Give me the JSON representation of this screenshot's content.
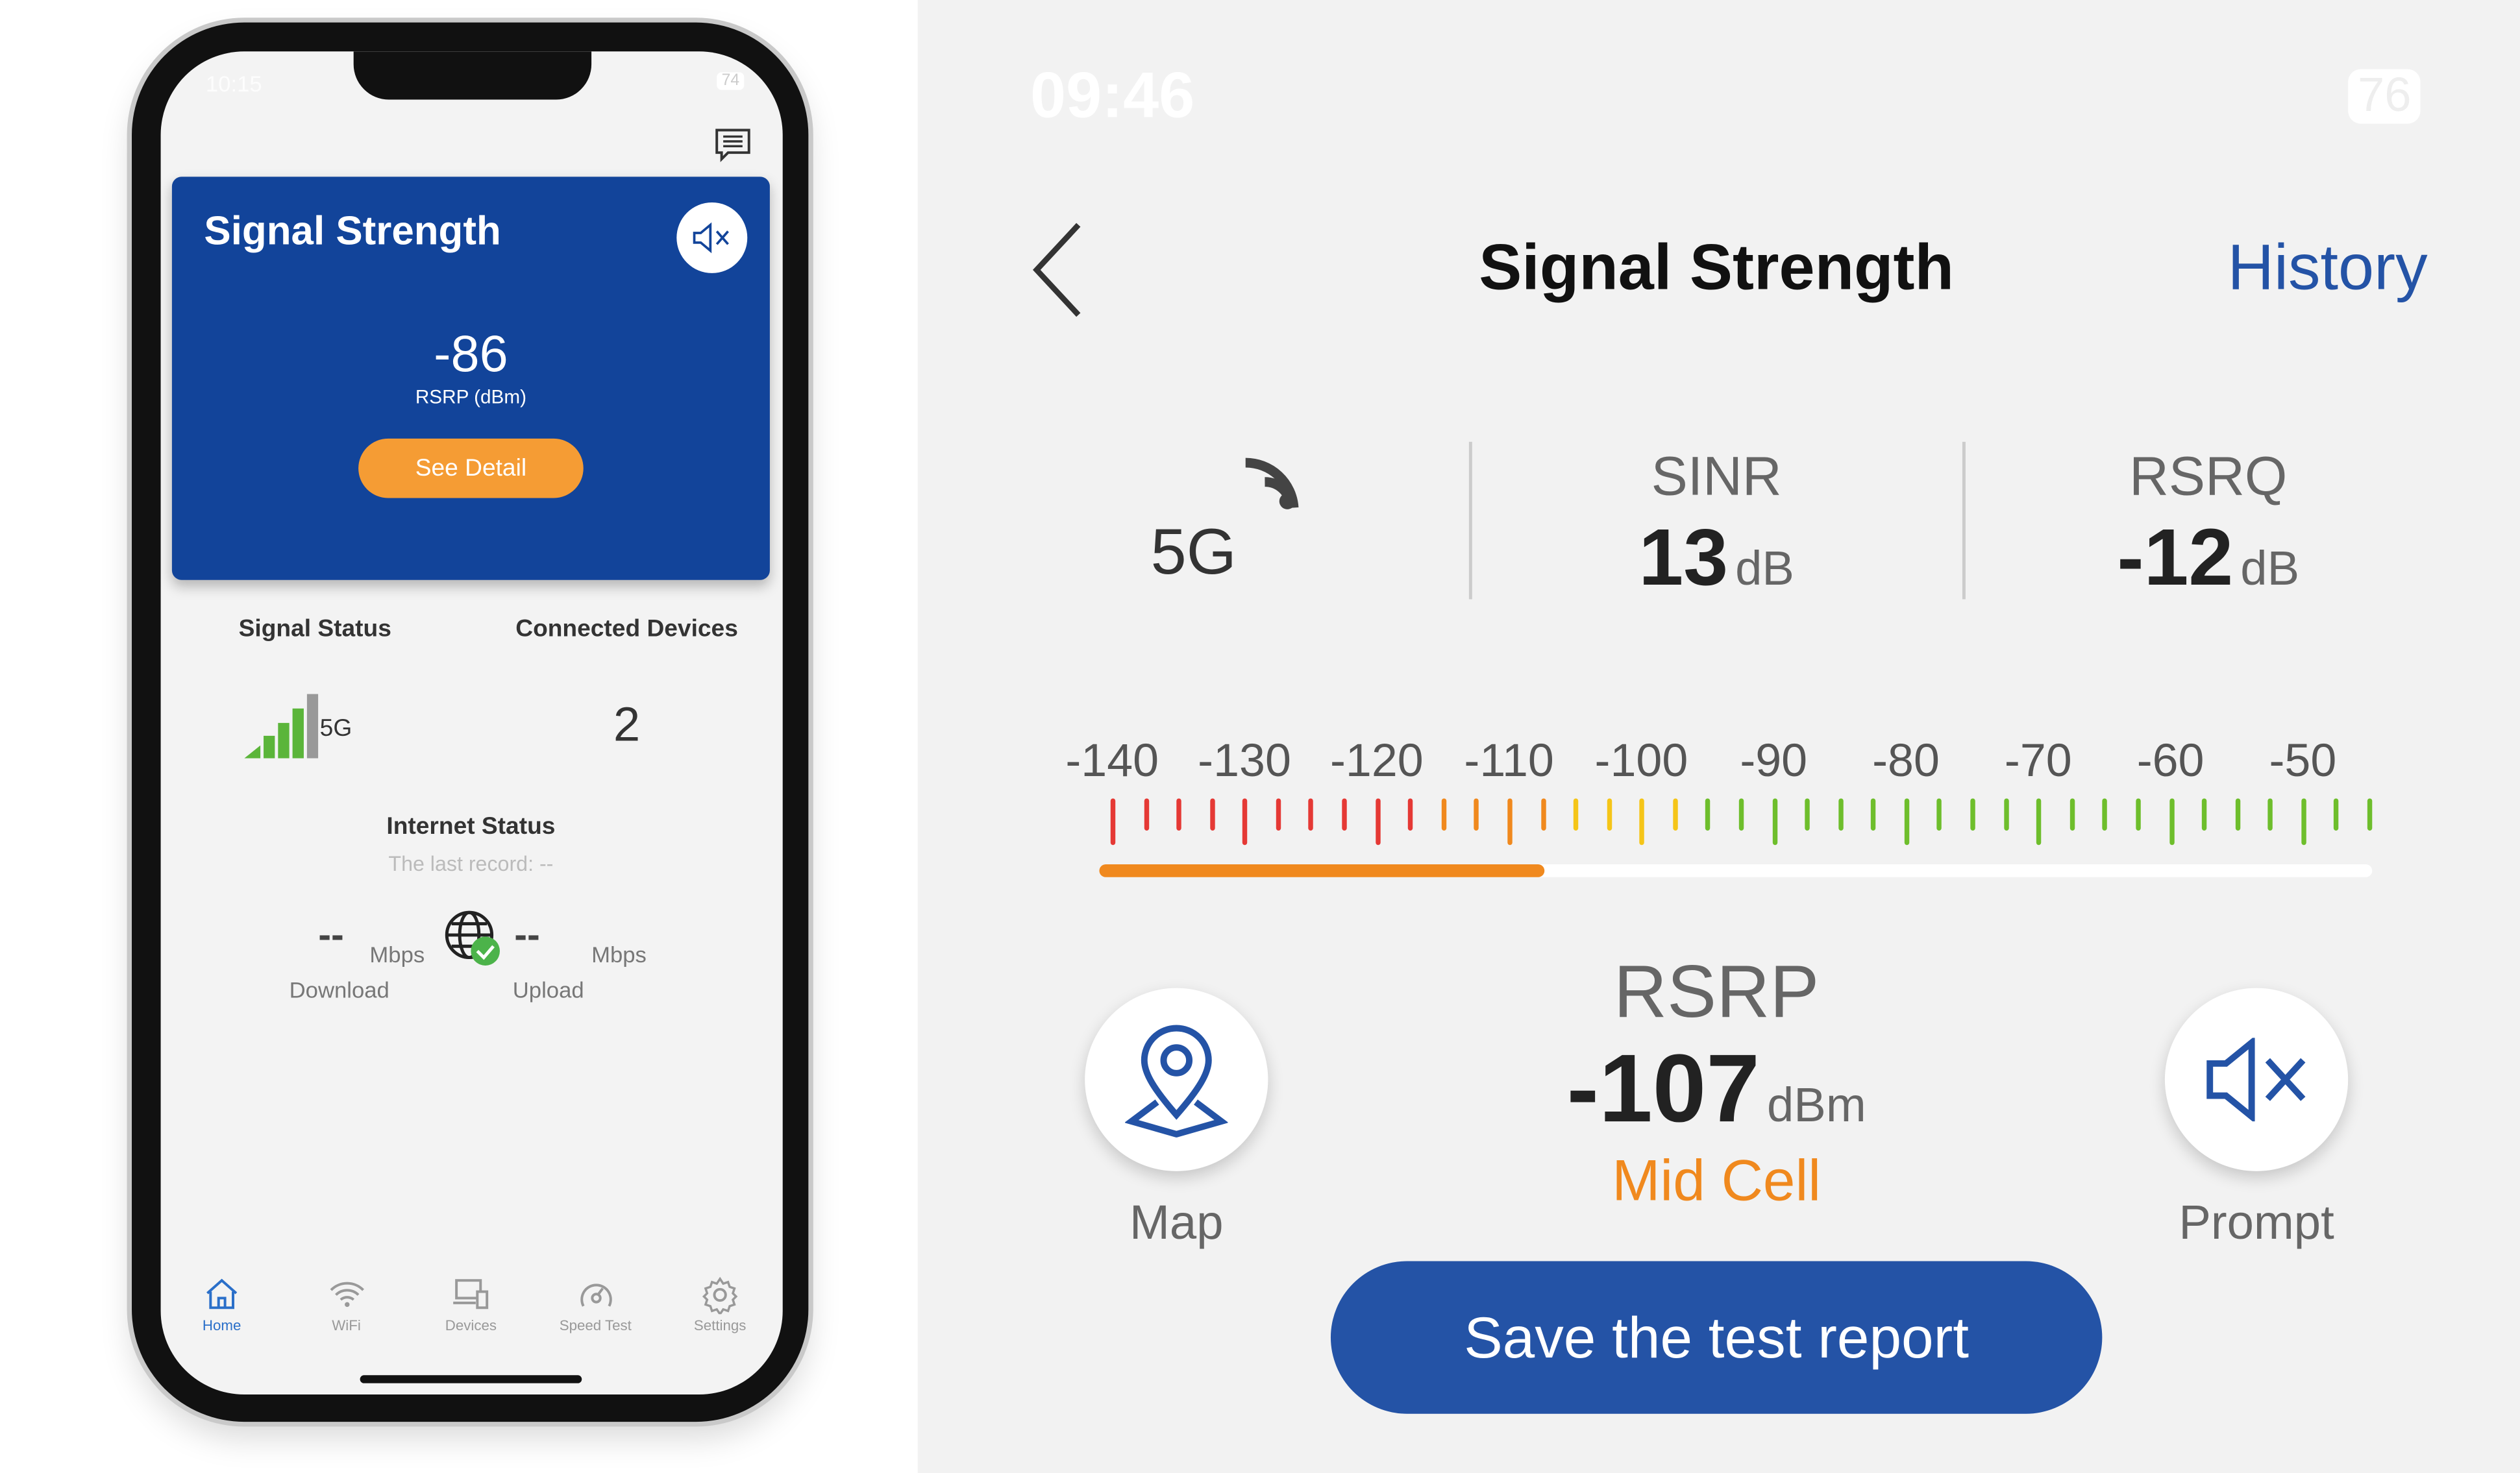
{
  "phone": {
    "status_time": "10:15",
    "battery": "74",
    "card": {
      "title": "Signal Strength",
      "value": "-86",
      "unit": "RSRP (dBm)",
      "button": "See Detail"
    },
    "signal_status": {
      "label": "Signal Status",
      "network": "5G",
      "bars_active": 4,
      "bars_total": 5
    },
    "connected_devices": {
      "label": "Connected Devices",
      "count": "2"
    },
    "internet": {
      "title": "Internet Status",
      "last_record": "The last record: --",
      "download": {
        "value": "--",
        "unit": "Mbps",
        "label": "Download"
      },
      "upload": {
        "value": "--",
        "unit": "Mbps",
        "label": "Upload"
      }
    },
    "nav": [
      {
        "label": "Home",
        "icon": "home-icon",
        "active": true
      },
      {
        "label": "WiFi",
        "icon": "wifi-icon"
      },
      {
        "label": "Devices",
        "icon": "devices-icon"
      },
      {
        "label": "Speed Test",
        "icon": "speedometer-icon"
      },
      {
        "label": "Settings",
        "icon": "gear-icon"
      }
    ]
  },
  "detail": {
    "status_time": "09:46",
    "battery": "76",
    "title": "Signal Strength",
    "history": "History",
    "network": "5G",
    "sinr": {
      "label": "SINR",
      "value": "13",
      "unit": "dB"
    },
    "rsrq": {
      "label": "RSRQ",
      "value": "-12",
      "unit": "dB"
    },
    "scale": {
      "labels": [
        "-140",
        "-130",
        "-120",
        "-110",
        "-100",
        "-90",
        "-80",
        "-70",
        "-60",
        "-50"
      ],
      "min": -140,
      "step": 2.5,
      "tick_count": 39,
      "fill_percent": 35,
      "colors": {
        "red": "#e53935",
        "orange": "#f0891e",
        "yellow": "#f5c518",
        "green": "#6ebe2c"
      }
    },
    "rsrp": {
      "label": "RSRP",
      "value": "-107",
      "unit": "dBm",
      "quality": "Mid Cell"
    },
    "map": "Map",
    "prompt": "Prompt",
    "save": "Save the test report",
    "colors": {
      "primary": "#2453a6",
      "accent": "#f0891e"
    }
  }
}
